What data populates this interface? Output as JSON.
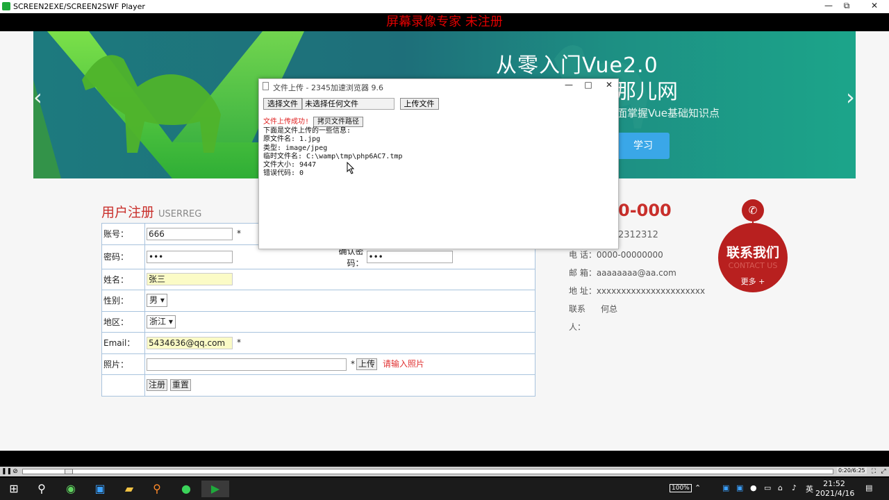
{
  "window": {
    "title": "SCREEN2EXE/SCREEN2SWF Player",
    "minimize": "—",
    "restore": "⧉",
    "close": "✕"
  },
  "recording_banner": "屏幕录像专家  未注册",
  "banner": {
    "heading_line1": "从零入门Vue2.0",
    "heading_line2": "那儿网",
    "subtitle": "面掌握Vue基础知识点",
    "button": "学习",
    "prev": "‹",
    "next": "›"
  },
  "registration": {
    "title": "用户注册",
    "title_en": "USERREG",
    "rows": {
      "account_label": "账号：",
      "account_value": "666",
      "password_label": "密码：",
      "password_value": "•••",
      "confirm_label": "确认密码：",
      "confirm_value": "•••",
      "name_label": "姓名：",
      "name_value": "张三",
      "gender_label": "性别：",
      "gender_value": "男 ▾",
      "region_label": "地区：",
      "region_value": "浙江 ▾",
      "email_label": "Email：",
      "email_value": "5434636@qq.com",
      "photo_label": "照片：",
      "photo_upload": "上传",
      "photo_hint": "请输入照片",
      "required_mark": "*",
      "submit": "注册",
      "reset": "重置"
    }
  },
  "contact": {
    "phone_big": "0-000",
    "phone_small": "2312312",
    "tel_label": "电  话：",
    "tel_value": "0000-00000000",
    "mail_label": "邮  箱：",
    "mail_value": "aaaaaaaa@aa.com",
    "addr_label": "地  址：",
    "addr_value": "xxxxxxxxxxxxxxxxxxxxxx",
    "person_label": "联系",
    "person_label2": "人：",
    "person_value": "何总",
    "badge_title": "联系我们",
    "badge_en": "CONTACT US",
    "badge_more": "更多 +",
    "phone_icon": "✆"
  },
  "popup": {
    "title": "文件上传 - 2345加速浏览器 9.6",
    "choose_file": "选择文件",
    "no_file": "未选择任何文件",
    "upload_file": "上传文件",
    "success": "文件上传成功!",
    "copy_path": "拷贝文件路径",
    "info_lines": [
      "下面是文件上传的一些信息:",
      "原文件名: 1.jpg",
      "类型: image/jpeg",
      "临时文件名: C:\\wamp\\tmp\\php6AC7.tmp",
      "文件大小: 9447",
      "错误代码: 0"
    ]
  },
  "player": {
    "time": "0:20/6:25",
    "progress_fraction": 0.052
  },
  "taskbar": {
    "battery": "100%",
    "ime": "英",
    "time": "21:52",
    "date": "2021/4/16"
  }
}
